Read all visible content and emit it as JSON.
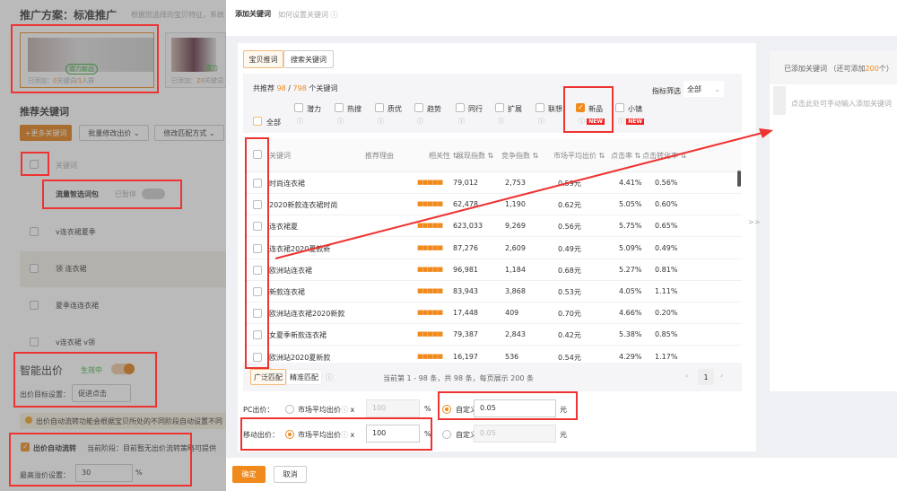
{
  "bg": {
    "title": "推广方案：标准推广",
    "subtitle": "根据您选择的宝贝特征，系统",
    "item1_badge": "潜力新品",
    "item1_stats_prefix": "已添加：",
    "item1_kw": "0",
    "item1_kw_unit": "关键词",
    "item1_crowd": "/1",
    "item1_crowd_unit": "人群",
    "item2_badge": "潜力",
    "item2_stats_prefix": "已添加：",
    "item2_kw": "20",
    "item2_kw_unit": "关键词",
    "rec_title": "推荐关键词",
    "more_btn": "+更多关键词",
    "batch_price": "批量修改出价",
    "match_mode": "修改匹配方式",
    "kw_header": "关键词",
    "pack_label": "流量智选词包",
    "pack_status": "已暂停",
    "keywords": [
      "v连衣裙夏季",
      "领 连衣裙",
      "夏季连连衣裙",
      "v连衣裙 v领"
    ],
    "smart_title": "智能出价",
    "smart_status": "生效中",
    "target_label": "出价目标设置：",
    "target_value": "促进点击",
    "notice": "出价自动流转功能会根据宝贝所处的不同阶段自动设置不同",
    "auto_label": "出价自动流转",
    "stage_label": "当前阶段：",
    "stage_value": "目前暂无出价流转策略可提供",
    "max_label": "最高溢价设置：",
    "max_value": "30",
    "max_unit": "%"
  },
  "modal": {
    "title": "添加关键词",
    "help": "如何设置关键词",
    "tabs": [
      "宝贝推词",
      "搜索关键词"
    ],
    "count_prefix": "共推荐",
    "count_a": "98",
    "count_sep": "/",
    "count_b": "798",
    "count_suffix": "个关键词",
    "filter_label": "指标筛选",
    "filter_value": "全部",
    "all_label": "全部",
    "filters": [
      {
        "label": "潜力",
        "checked": false
      },
      {
        "label": "热搜",
        "checked": false
      },
      {
        "label": "质优",
        "checked": false
      },
      {
        "label": "趋势",
        "checked": false
      },
      {
        "label": "同行",
        "checked": false
      },
      {
        "label": "扩展",
        "checked": false
      },
      {
        "label": "联想",
        "checked": false
      },
      {
        "label": "新品",
        "checked": true,
        "badge": "NEW"
      },
      {
        "label": "小镇",
        "checked": false,
        "badge": "NEW"
      }
    ],
    "columns": [
      "关键词",
      "推荐理由",
      "相关性 ⇅",
      "展现指数 ⇅",
      "竞争指数 ⇅",
      "市场平均出价 ⇅",
      "点击率 ⇅",
      "点击转化率 ⇅"
    ],
    "rows": [
      {
        "kw": "时尚连衣裙",
        "rel": "■■■■■",
        "imp": "79,012",
        "comp": "2,753",
        "price": "0.59元",
        "ctr": "4.41%",
        "cvr": "0.56%"
      },
      {
        "kw": "2020新款连衣裙时尚",
        "rel": "■■■■■",
        "imp": "62,478",
        "comp": "1,190",
        "price": "0.62元",
        "ctr": "5.05%",
        "cvr": "0.60%"
      },
      {
        "kw": "连衣裙夏",
        "rel": "■■■■■",
        "imp": "623,033",
        "comp": "9,269",
        "price": "0.56元",
        "ctr": "5.75%",
        "cvr": "0.65%"
      },
      {
        "kw": "连衣裙2020夏款新",
        "rel": "■■■■■",
        "imp": "87,276",
        "comp": "2,609",
        "price": "0.49元",
        "ctr": "5.09%",
        "cvr": "0.49%"
      },
      {
        "kw": "欧洲站连衣裙",
        "rel": "■■■■■",
        "imp": "96,981",
        "comp": "1,184",
        "price": "0.68元",
        "ctr": "5.27%",
        "cvr": "0.81%"
      },
      {
        "kw": "新款连衣裙",
        "rel": "■■■■■",
        "imp": "83,943",
        "comp": "3,868",
        "price": "0.53元",
        "ctr": "4.05%",
        "cvr": "1.11%"
      },
      {
        "kw": "欧洲站连衣裙2020新款",
        "rel": "■■■■■",
        "imp": "17,448",
        "comp": "409",
        "price": "0.70元",
        "ctr": "4.66%",
        "cvr": "0.20%"
      },
      {
        "kw": "女夏季新款连衣裙",
        "rel": "■■■■■",
        "imp": "79,387",
        "comp": "2,843",
        "price": "0.42元",
        "ctr": "5.38%",
        "cvr": "0.85%"
      },
      {
        "kw": "欧洲站2020夏新款",
        "rel": "■■■■■",
        "imp": "16,197",
        "comp": "536",
        "price": "0.54元",
        "ctr": "4.29%",
        "cvr": "1.17%"
      }
    ],
    "match_broad": "广泛匹配",
    "match_exact": "精准匹配",
    "pager_text": "当前第 1 - 98 条，共 98 条，每页展示 200 条",
    "page": "1",
    "pc_label": "PC出价：",
    "mobile_label": "移动出价：",
    "market_label": "市场平均出价",
    "times": "x",
    "pct": "%",
    "custom_label": "自定义出价：",
    "yuan": "元",
    "pc_market_value": "100",
    "pc_custom_value": "0.05",
    "mobile_market_value": "100",
    "mobile_custom_value": "0.05",
    "transfer": ">>",
    "added_prefix": "已添加关键词 （还可添加",
    "added_count": "200",
    "added_suffix": "个）",
    "manual_hint": "点击此处可手动输入添加关键词",
    "ok": "确定",
    "cancel": "取消"
  }
}
